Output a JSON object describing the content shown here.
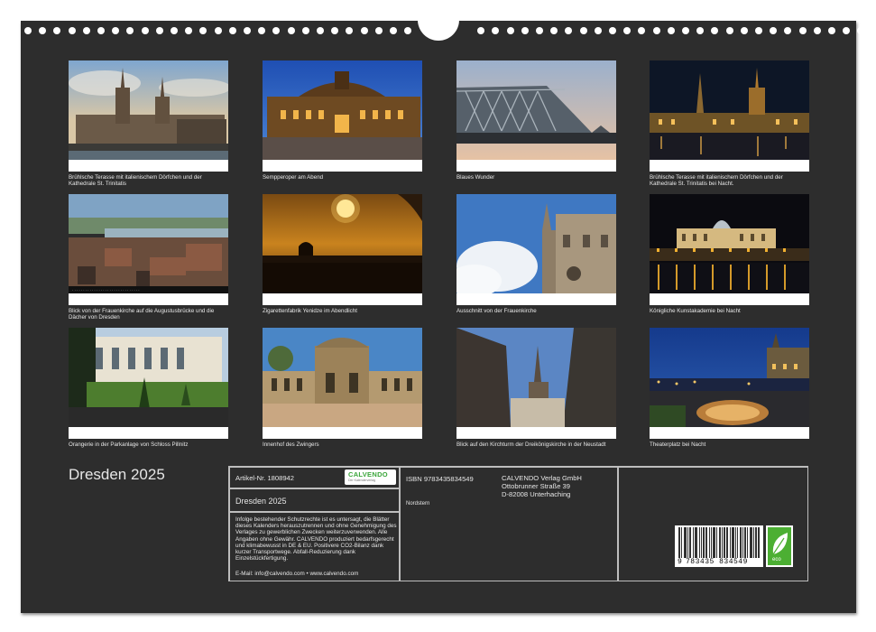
{
  "calendar_title": "Dresden 2025",
  "photos": [
    {
      "caption": "Brühlsche Terasse mit italienischem Dörfchen und der Kathedrale St. Trinitatis"
    },
    {
      "caption": "Sempperoper am Abend"
    },
    {
      "caption": "Blaues Wunder"
    },
    {
      "caption": "Brühlsche Terasse mit italienischem Dörfchen und der Kathedrale St. Trinitatis bei Nacht."
    },
    {
      "caption": "Blick von der Frauenkirche auf die Augustusbrücke und die Dächer von Dresden"
    },
    {
      "caption": "Zigarettenfabrik Yenidze im Abendlicht"
    },
    {
      "caption": "Ausschnitt von der Frauenkirche"
    },
    {
      "caption": "Königliche Kunstakademie bei Nacht"
    },
    {
      "caption": "Orangerie in der Parkanlage von Schloss Pillnitz"
    },
    {
      "caption": "Innenhof des Zwingers"
    },
    {
      "caption": "Blick auf den Kirchturm der Dreikönigskirche in der Neustadt"
    },
    {
      "caption": "Theaterplatz bei Nacht"
    }
  ],
  "info": {
    "article_no": "Artikel-Nr. 1808942",
    "product_title": "Dresden 2025",
    "legal_text": "Infolge bestehender Schutzrechte ist es untersagt, die Blätter dieses Kalenders herauszutrennen und ohne Genehmigung des Verlages zu gewerblichen Zwecken weiterzuverwenden. Alle Angaben ohne Gewähr. CALVENDO produziert bedarfsgerecht und klimabewusst in DE & EU. Positivere CO2-Bilanz dank kurzer Transportwege. Abfall-Reduzierung dank Einzelstückfertigung.",
    "contact": "E-Mail: info@calvendo.com • www.calvendo.com",
    "isbn": "ISBN 9783435834549",
    "author": "Nordstern",
    "publisher_lines": [
      "CALVENDO Verlag GmbH",
      "Ottobrunner Straße 39",
      "D-82008 Unterhaching"
    ],
    "logo_text": "CALVENDO",
    "logo_subtext": "Der Kalenderverlag",
    "barcode_lead": "9",
    "barcode_number": "783435 834549",
    "eco_label": "eco"
  },
  "colors": {
    "sheet": "#2d2d2d",
    "text": "#e6e6e6",
    "eco_green": "#4caf33",
    "brand_green": "#3aa63a"
  }
}
